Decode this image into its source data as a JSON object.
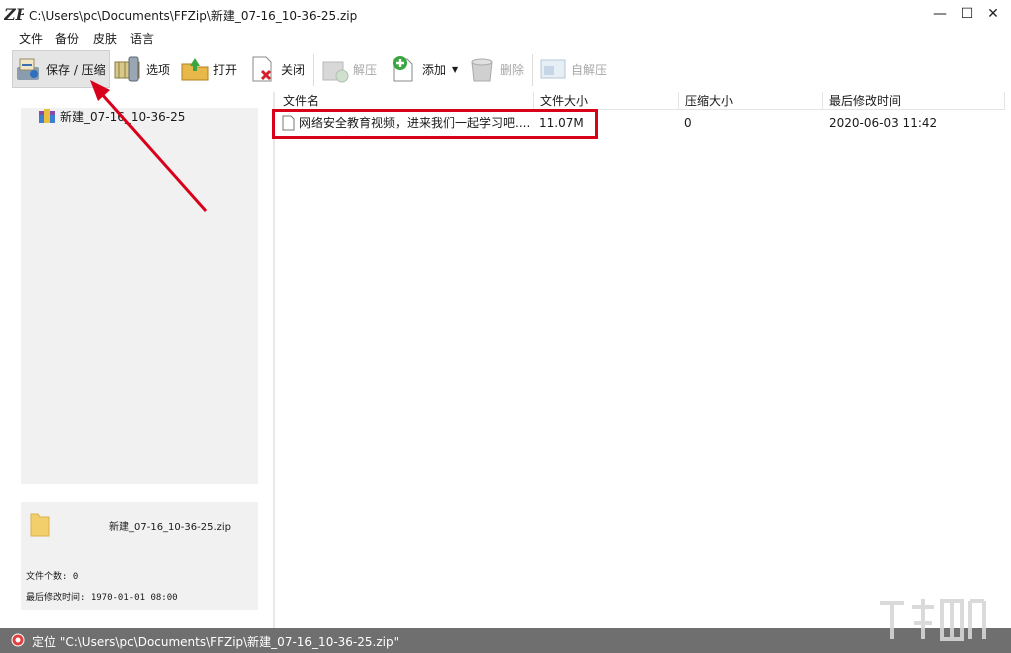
{
  "window": {
    "title": "C:\\Users\\pc\\Documents\\FFZip\\新建_07-16_10-36-25.zip",
    "minimize": "—",
    "maximize": "☐",
    "close": "✕"
  },
  "menu": [
    "文件",
    "备份",
    "皮肤",
    "语言"
  ],
  "toolbar": {
    "save": "保存 / 压缩",
    "options": "选项",
    "open": "打开",
    "close": "关闭",
    "extract": "解压",
    "add": "添加",
    "delete": "删除",
    "selfextract": "自解压"
  },
  "tree": {
    "root": "新建_07-16_10-36-25"
  },
  "info": {
    "name": "新建_07-16_10-36-25.zip",
    "count": "文件个数: 0",
    "modified": "最后修改时间: 1970-01-01 08:00"
  },
  "columns": [
    "文件名",
    "文件大小",
    "压缩大小",
    "最后修改时间"
  ],
  "rows": [
    {
      "name": "网络安全教育视频，进来我们一起学习吧....",
      "size": "11.07M",
      "packed": "0",
      "modified": "2020-06-03 11:42"
    }
  ],
  "status": {
    "text": "定位 \"C:\\Users\\pc\\Documents\\FFZip\\新建_07-16_10-36-25.zip\""
  },
  "colors": {
    "highlight": "#d9001b",
    "arrow": "#d9001b",
    "statusbar": "#6f6f6f"
  }
}
